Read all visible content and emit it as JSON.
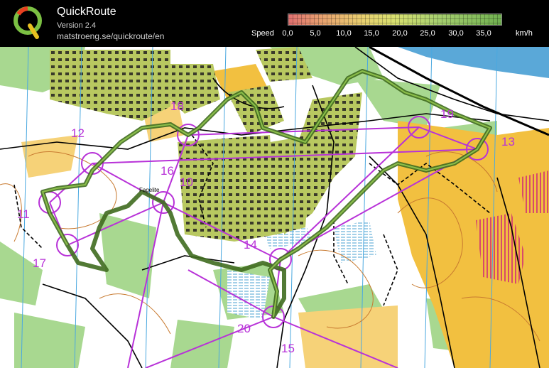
{
  "app": {
    "title": "QuickRoute",
    "version": "Version 2.4",
    "url": "matstroeng.se/quickroute/en"
  },
  "speed_legend": {
    "label": "Speed",
    "ticks": [
      "0,0",
      "5,0",
      "10,0",
      "15,0",
      "20,0",
      "25,0",
      "30,0",
      "35,0"
    ],
    "unit": "km/h",
    "colors": {
      "slow": "#e07070",
      "medium": "#e8d070",
      "fast": "#70b050"
    }
  },
  "map": {
    "controls": [
      "10",
      "11",
      "12",
      "13",
      "14",
      "15",
      "16",
      "17",
      "18",
      "19",
      "20"
    ],
    "place_label": "Fagelite",
    "colors": {
      "course": "#b832d8",
      "route": "#3f6b1f",
      "open_land": "#f2c040",
      "forest": "#ffffff",
      "green": "#a8d890",
      "water": "#5aa8d8",
      "buildings": "#b8c860"
    }
  }
}
